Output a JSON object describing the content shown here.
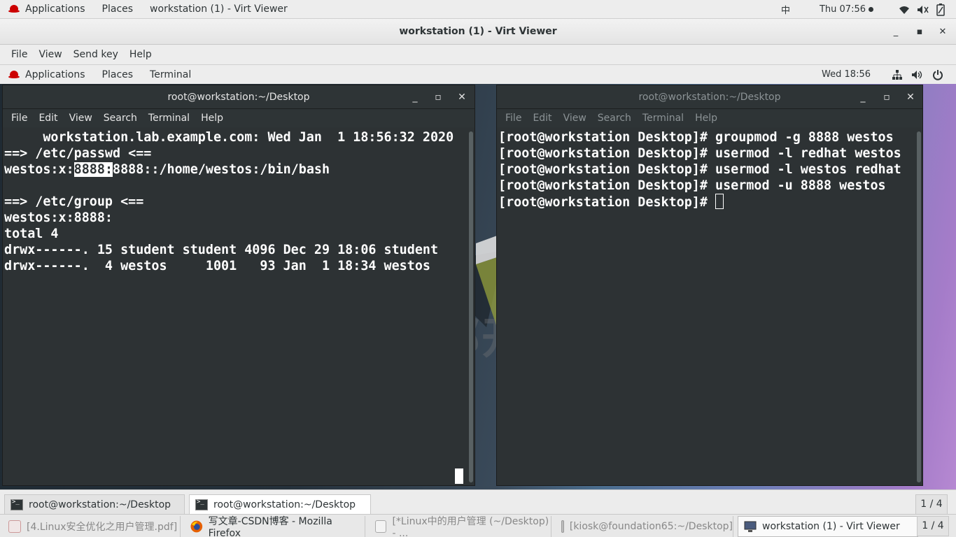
{
  "host_topbar": {
    "applications": "Applications",
    "places": "Places",
    "active_window": "workstation (1) - Virt Viewer",
    "input_method": "中",
    "clock": "Thu 07:56"
  },
  "vv_window": {
    "title": "workstation (1) - Virt Viewer",
    "minimize": "_",
    "maximize": "▪",
    "close": "✕",
    "menu": [
      "File",
      "View",
      "Send key",
      "Help"
    ]
  },
  "guest_topbar": {
    "applications": "Applications",
    "places": "Places",
    "terminal": "Terminal",
    "clock": "Wed 18:56"
  },
  "watermark": "西部开源",
  "terminal_left": {
    "title": "root@workstation:~/Desktop",
    "menu": [
      "File",
      "Edit",
      "View",
      "Search",
      "Terminal",
      "Help"
    ],
    "lines": [
      "     workstation.lab.example.com: Wed Jan  1 18:56:32 2020",
      "",
      "==> /etc/passwd <==",
      "westos:x:",
      "",
      "==> /etc/group <==",
      "westos:x:8888:",
      "total 4",
      "drwx------. 15 student student 4096 Dec 29 18:06 student",
      "drwx------.  4 westos     1001   93 Jan  1 18:34 westos"
    ],
    "passwd_highlight": "8888:",
    "passwd_rest": "8888::/home/westos:/bin/bash"
  },
  "terminal_right": {
    "title": "root@workstation:~/Desktop",
    "menu": [
      "File",
      "Edit",
      "View",
      "Search",
      "Terminal",
      "Help"
    ],
    "lines": [
      "[root@workstation Desktop]# groupmod -g 8888 westos",
      "[root@workstation Desktop]# usermod -l redhat westos",
      "[root@workstation Desktop]# usermod -l westos redhat",
      "[root@workstation Desktop]# usermod -u 8888 westos",
      "[root@workstation Desktop]# "
    ]
  },
  "guest_taskbar": {
    "tasks": [
      "root@workstation:~/Desktop",
      "root@workstation:~/Desktop"
    ],
    "pager": "1 / 4"
  },
  "host_taskbar": {
    "tasks": [
      "[4.Linux安全优化之用户管理.pdf]",
      "写文章-CSDN博客 - Mozilla Firefox",
      "[*Linux中的用户管理 (~/Desktop) - ...",
      "[kiosk@foundation65:~/Desktop]",
      "workstation (1) - Virt Viewer"
    ],
    "pager": "1 / 4"
  }
}
